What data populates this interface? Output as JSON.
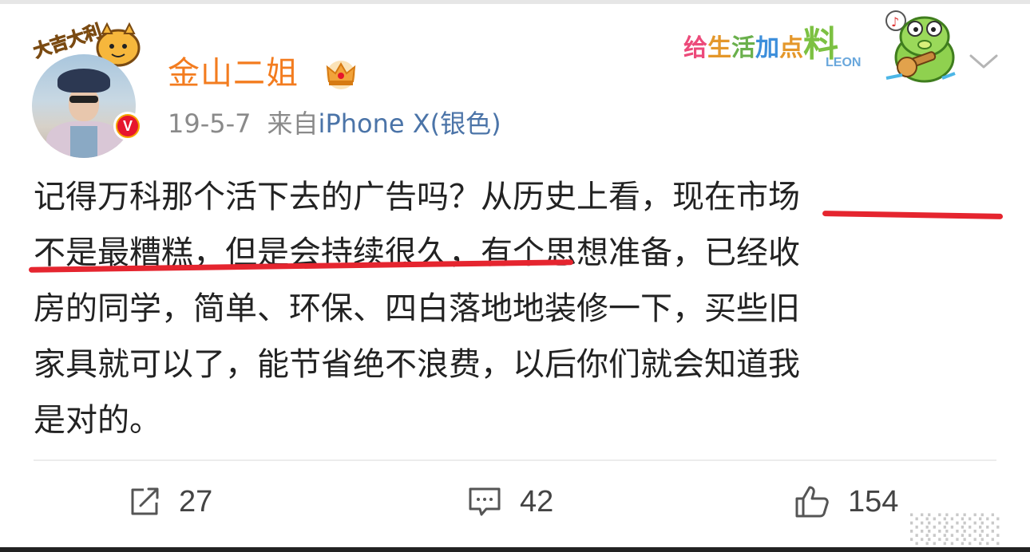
{
  "post": {
    "username": "金山二姐",
    "date": "19-5-7",
    "source_prefix": "来自",
    "source_device": "iPhone X(银色)",
    "avatar_sticker_text": "大吉大利",
    "header_sticker": {
      "text_1": "给",
      "text_2": "生",
      "text_3": "活",
      "text_4": "加",
      "text_5": "点",
      "text_6": "料",
      "brand": "LEON"
    },
    "content_lines": [
      {
        "plain": "记得万科那个活下去的广告吗？从历史上看，",
        "highlight": "现在市场"
      },
      {
        "highlight": "不是最糟糕，但是会持续很久，",
        "plain": "有个思想准备，已经收"
      },
      {
        "plain": "房的同学，简单、环保、四白落地地装修一下，买些旧"
      },
      {
        "plain": "家具就可以了，能节省绝不浪费，以后你们就会知道我"
      },
      {
        "plain": "是对的。"
      }
    ],
    "verified_badge": "V"
  },
  "actions": {
    "repost_count": "27",
    "comment_count": "42",
    "like_count": "154"
  },
  "colors": {
    "username": "#f37c1f",
    "source_link": "#4b74a8",
    "highlight_underline": "#e5252f",
    "meta_gray": "#8a8a8a"
  },
  "watermark": "░░░░░"
}
